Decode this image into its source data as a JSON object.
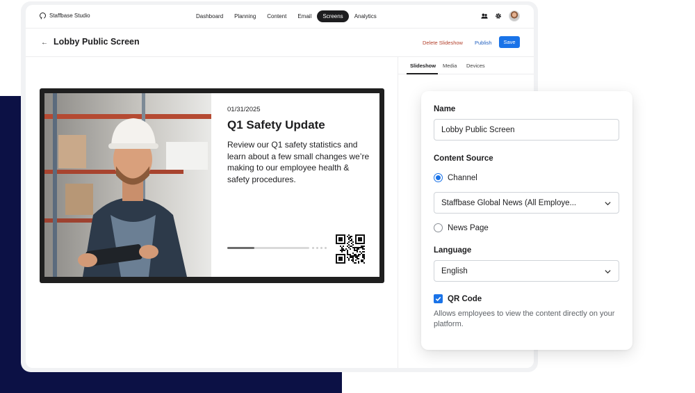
{
  "app": {
    "brand": "Staffbase Studio"
  },
  "nav": {
    "items": [
      {
        "label": "Dashboard",
        "active": false
      },
      {
        "label": "Planning",
        "active": false
      },
      {
        "label": "Content",
        "active": false
      },
      {
        "label": "Email",
        "active": false
      },
      {
        "label": "Screens",
        "active": true
      },
      {
        "label": "Analytics",
        "active": false
      }
    ],
    "icons": [
      "people-icon",
      "gear-icon",
      "avatar"
    ]
  },
  "page": {
    "back_icon": "arrow-left-icon",
    "title": "Lobby Public Screen",
    "delete_label": "Delete Slideshow",
    "publish_label": "Publish",
    "save_label": "Save"
  },
  "tabs": [
    {
      "label": "Slideshow",
      "active": true
    },
    {
      "label": "Media",
      "active": false
    },
    {
      "label": "Devices",
      "active": false
    }
  ],
  "slide": {
    "date": "01/31/2025",
    "title": "Q1 Safety Update",
    "body": "Review our Q1 safety statistics and learn about a few small changes we’re making to our employee health & safety procedures.",
    "progress": 0.33,
    "qr_icon": "qr-code-icon"
  },
  "settings": {
    "name_label": "Name",
    "name_value": "Lobby Public Screen",
    "content_source_label": "Content Source",
    "option_channel": "Channel",
    "channel_selected": true,
    "channel_value": "Staffbase Global News (All Employe...",
    "option_news_page": "News Page",
    "news_page_selected": false,
    "language_label": "Language",
    "language_value": "English",
    "qr_label": "QR Code",
    "qr_checked": true,
    "qr_help": "Allows employees to view the content directly on your platform."
  },
  "colors": {
    "accent": "#1a73e8",
    "navy_background": "#0c1145",
    "delete": "#b3412c",
    "publish": "#1f5fbf"
  }
}
